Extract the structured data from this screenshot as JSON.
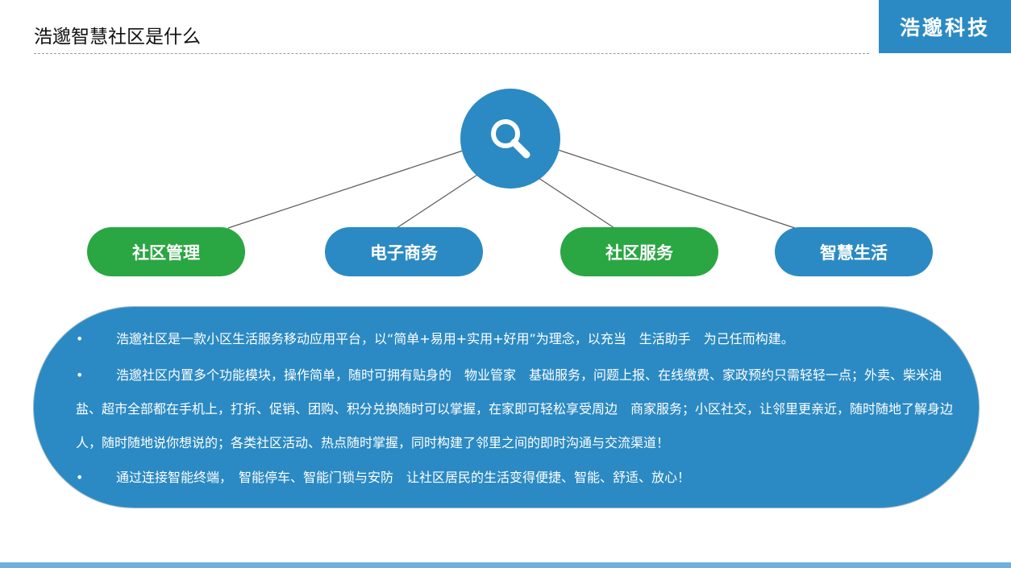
{
  "header": {
    "title": "浩邈智慧社区是什么",
    "brand": "浩邈科技"
  },
  "diagram": {
    "hub_icon": "search-icon",
    "nodes": [
      {
        "label": "社区管理",
        "color": "#2aa643"
      },
      {
        "label": "电子商务",
        "color": "#2b8ac3"
      },
      {
        "label": "社区服务",
        "color": "#2aa643"
      },
      {
        "label": "智慧生活",
        "color": "#2b8ac3"
      }
    ]
  },
  "info": {
    "bullet": "•",
    "paragraphs": [
      "浩邈社区是一款小区生活服务移动应用平台，以“简单+易用+实用+好用”为理念，以充当　生活助手　为己任而构建。",
      "浩邈社区内置多个功能模块，操作简单，随时可拥有贴身的　物业管家　基础服务，问题上报、在线缴费、家政预约只需轻轻一点；外卖、柴米油盐、超市全部都在手机上，打折、促销、团购、积分兑换随时可以掌握，在家即可轻松享受周边　商家服务；小区社交，让邻里更亲近，随时随地了解身边人，随时随地说你想说的；各类社区活动、热点随时掌握，同时构建了邻里之间的即时沟通与交流渠道！",
      "通过连接智能终端，　智能停车、智能门锁与安防　让社区居民的生活变得便捷、智能、舒适、放心！"
    ]
  },
  "colors": {
    "blue": "#2b8ac3",
    "green": "#2aa643",
    "bottom_bar": "#6fb0dc"
  }
}
